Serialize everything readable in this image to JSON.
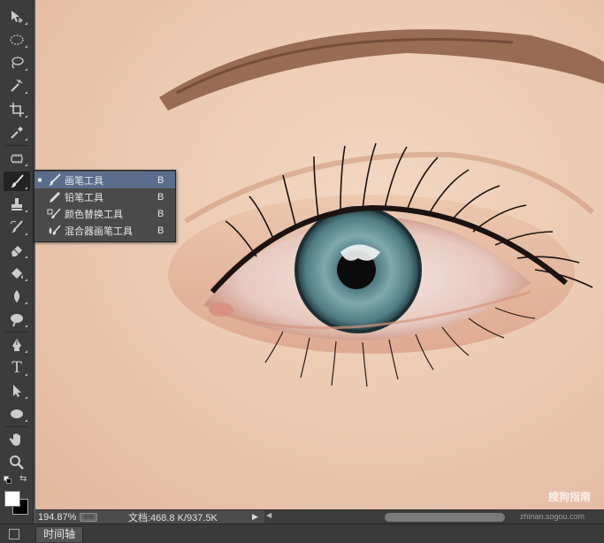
{
  "toolbar": {
    "tools": [
      {
        "id": "move",
        "icon": "move-icon"
      },
      {
        "id": "marquee",
        "icon": "elliptical-marquee-icon"
      },
      {
        "id": "lasso",
        "icon": "lasso-icon"
      },
      {
        "id": "magic-wand",
        "icon": "magic-wand-icon"
      },
      {
        "id": "crop",
        "icon": "crop-icon"
      },
      {
        "id": "eyedropper",
        "icon": "eyedropper-icon"
      },
      {
        "id": "healing",
        "icon": "spot-healing-icon"
      },
      {
        "id": "brush",
        "icon": "brush-icon",
        "active": true
      },
      {
        "id": "stamp",
        "icon": "clone-stamp-icon"
      },
      {
        "id": "history-brush",
        "icon": "history-brush-icon"
      },
      {
        "id": "eraser",
        "icon": "eraser-icon"
      },
      {
        "id": "paint-bucket",
        "icon": "paint-bucket-icon"
      },
      {
        "id": "blur",
        "icon": "blur-icon"
      },
      {
        "id": "dodge",
        "icon": "dodge-icon"
      },
      {
        "id": "pen",
        "icon": "pen-icon"
      },
      {
        "id": "type",
        "icon": "type-icon"
      },
      {
        "id": "path-select",
        "icon": "path-selection-icon"
      },
      {
        "id": "ellipse",
        "icon": "ellipse-shape-icon"
      },
      {
        "id": "hand",
        "icon": "hand-icon"
      },
      {
        "id": "zoom",
        "icon": "zoom-icon"
      }
    ],
    "type_glyph": "T",
    "foreground_color": "#ffffff",
    "background_color": "#000000"
  },
  "flyout": {
    "items": [
      {
        "label": "画笔工具",
        "key": "B",
        "selected": true,
        "bullet": "■"
      },
      {
        "label": "铅笔工具",
        "key": "B"
      },
      {
        "label": "颜色替换工具",
        "key": "B"
      },
      {
        "label": "混合器画笔工具",
        "key": "B"
      }
    ]
  },
  "status": {
    "zoom": "194.87%",
    "doc_info": "文档:468.8 K/937.5K",
    "arrow": "▶",
    "scroll_left": "◀",
    "watermark_small": "zhinan.sogou.com"
  },
  "canvas": {
    "watermark": "搜狗指南"
  },
  "timeline": {
    "tab_label": "时间轴"
  },
  "colors": {
    "selection": "#5a6e8c",
    "panel": "#3c3c3c"
  }
}
